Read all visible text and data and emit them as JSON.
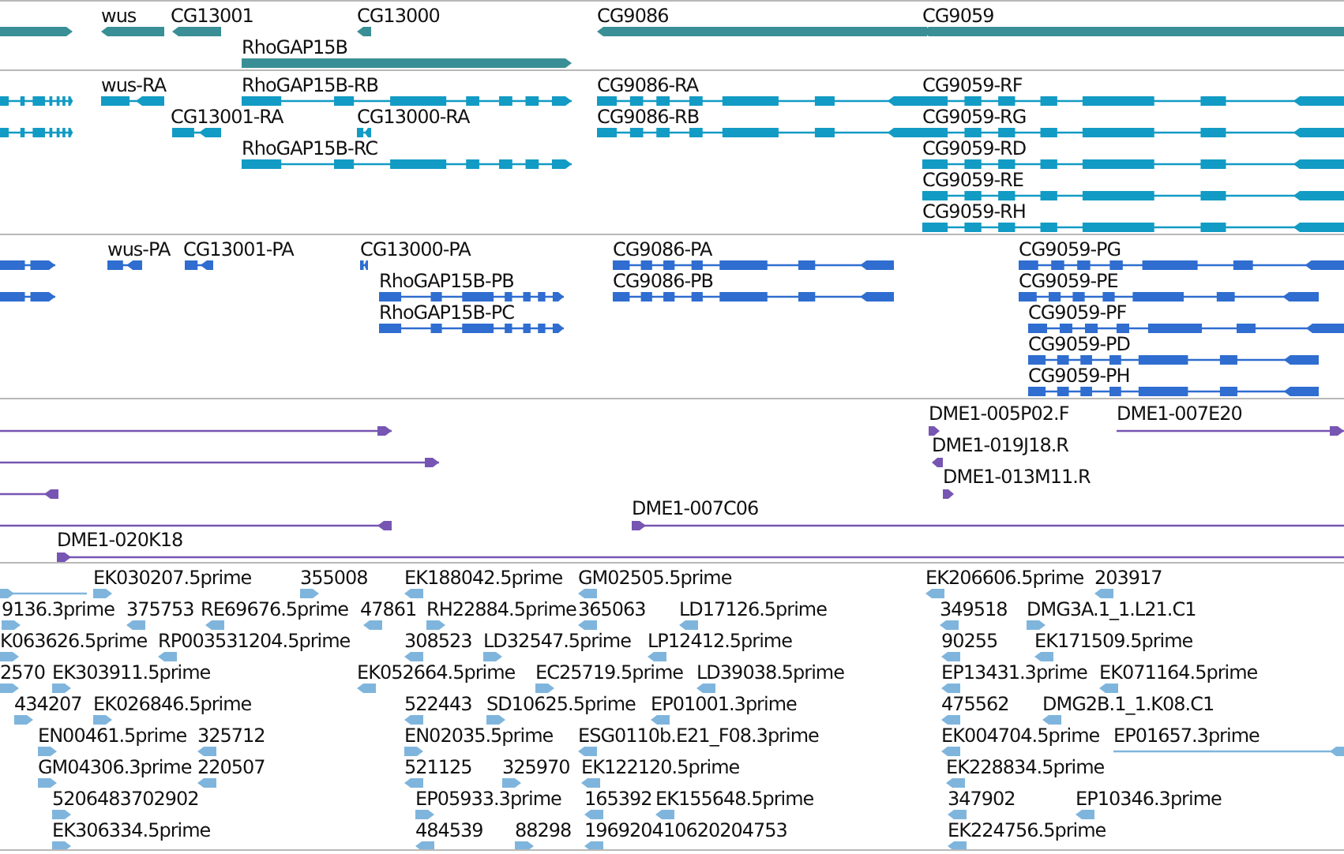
{
  "tracks": [
    {
      "kind": "gene",
      "features": [
        {
          "reverse": false
        },
        {
          "label": "wus",
          "reverse": true
        },
        {
          "label": "CG13001",
          "reverse": true
        },
        {
          "label": "CG13000",
          "reverse": true
        },
        {
          "label": "CG9086",
          "reverse": true
        },
        {
          "label": "CG9059",
          "reverse": true
        },
        {
          "label": "RhoGAP15B",
          "reverse": false
        }
      ]
    },
    {
      "kind": "transcript",
      "features": [
        {
          "reverse": false
        },
        {
          "label": "wus-RA",
          "reverse": true
        },
        {
          "label": "RhoGAP15B-RB",
          "reverse": false
        },
        {
          "label": "CG9086-RA",
          "reverse": true
        },
        {
          "label": "CG9059-RF",
          "reverse": true
        },
        {
          "reverse": false
        },
        {
          "label": "CG13001-RA",
          "reverse": true
        },
        {
          "label": "CG13000-RA",
          "reverse": true
        },
        {
          "label": "CG9086-RB",
          "reverse": true
        },
        {
          "label": "CG9059-RG",
          "reverse": true
        },
        {
          "label": "RhoGAP15B-RC",
          "reverse": false
        },
        {
          "label": "CG9059-RD",
          "reverse": true
        },
        {
          "label": "CG9059-RE",
          "reverse": true
        },
        {
          "label": "CG9059-RH",
          "reverse": true
        }
      ]
    },
    {
      "kind": "protein",
      "features": [
        {
          "reverse": false
        },
        {
          "label": "wus-PA",
          "reverse": true
        },
        {
          "label": "CG13001-PA",
          "reverse": true
        },
        {
          "label": "CG13000-PA",
          "reverse": true
        },
        {
          "label": "CG9086-PA",
          "reverse": true
        },
        {
          "label": "CG9059-PG",
          "reverse": true
        },
        {
          "reverse": false
        },
        {
          "label": "RhoGAP15B-PB",
          "reverse": false
        },
        {
          "label": "CG9086-PB",
          "reverse": true
        },
        {
          "label": "CG9059-PE",
          "reverse": true
        },
        {
          "label": "RhoGAP15B-PC",
          "reverse": false
        },
        {
          "label": "CG9059-PF",
          "reverse": true
        },
        {
          "label": "CG9059-PD",
          "reverse": true
        },
        {
          "label": "CG9059-PH",
          "reverse": true
        }
      ]
    },
    {
      "kind": "clone",
      "features": [
        {
          "reverse": false
        },
        {
          "label": "DME1-005P02.F",
          "reverse": false
        },
        {
          "label": "DME1-007E20",
          "reverse": false
        },
        {
          "reverse": false
        },
        {
          "label": "DME1-019J18.R",
          "reverse": true
        },
        {
          "reverse": true
        },
        {
          "label": "DME1-013M11.R",
          "reverse": false
        },
        {
          "reverse": true
        },
        {
          "label": "DME1-007C06",
          "reverse": false
        },
        {
          "label": "DME1-020K18",
          "reverse": false
        }
      ]
    },
    {
      "kind": "est",
      "features": [
        {
          "reverse": false
        },
        {
          "label": "EK030207.5prime",
          "reverse": false
        },
        {
          "label": "355008",
          "reverse": false
        },
        {
          "label": "EK188042.5prime",
          "reverse": true
        },
        {
          "label": "GM02505.5prime",
          "reverse": true
        },
        {
          "label": "EK206606.5prime",
          "reverse": true
        },
        {
          "label": "203917",
          "reverse": true
        },
        {
          "label": "9136.3prime",
          "reverse": false
        },
        {
          "label": "375753",
          "reverse": true
        },
        {
          "label": "RE69676.5prime",
          "reverse": true
        },
        {
          "label": "47861",
          "reverse": true
        },
        {
          "label": "RH22884.5prime",
          "reverse": false
        },
        {
          "label": "365063",
          "reverse": true
        },
        {
          "label": "LD17126.5prime",
          "reverse": true
        },
        {
          "label": "349518",
          "reverse": true
        },
        {
          "label": "DMG3A.1_1.L21.C1",
          "reverse": false
        },
        {
          "label": "K063626.5prime",
          "reverse": false
        },
        {
          "label": "RP003531204.5prime",
          "reverse": true
        },
        {
          "label": "308523",
          "reverse": true
        },
        {
          "label": "LD32547.5prime",
          "reverse": false
        },
        {
          "label": "LP12412.5prime",
          "reverse": true
        },
        {
          "label": "90255",
          "reverse": true
        },
        {
          "label": "EK171509.5prime",
          "reverse": true
        },
        {
          "label": "2570",
          "reverse": false
        },
        {
          "label": "EK303911.5prime",
          "reverse": false
        },
        {
          "label": "EK052664.5prime",
          "reverse": true
        },
        {
          "label": "EC25719.5prime",
          "reverse": false
        },
        {
          "label": "LD39038.5prime",
          "reverse": true
        },
        {
          "label": "EP13431.3prime",
          "reverse": true
        },
        {
          "label": "EK071164.5prime",
          "reverse": true
        },
        {
          "label": "434207",
          "reverse": false
        },
        {
          "label": "EK026846.5prime",
          "reverse": false
        },
        {
          "label": "522443",
          "reverse": true
        },
        {
          "label": "SD10625.5prime",
          "reverse": false
        },
        {
          "label": "EP01001.3prime",
          "reverse": true
        },
        {
          "label": "475562",
          "reverse": true
        },
        {
          "label": "DMG2B.1_1.K08.C1",
          "reverse": true
        },
        {
          "label": "EN00461.5prime",
          "reverse": false
        },
        {
          "label": "325712",
          "reverse": true
        },
        {
          "label": "EN02035.5prime",
          "reverse": false
        },
        {
          "label": "ESG0110b.E21_F08.3prime",
          "reverse": true
        },
        {
          "label": "EK004704.5prime",
          "reverse": true
        },
        {
          "label": "EP01657.3prime",
          "reverse": true
        },
        {
          "label": "GM04306.3prime",
          "reverse": false
        },
        {
          "label": "220507",
          "reverse": true
        },
        {
          "label": "521125",
          "reverse": true
        },
        {
          "label": "325970",
          "reverse": false
        },
        {
          "label": "EK122120.5prime",
          "reverse": true
        },
        {
          "label": "EK228834.5prime",
          "reverse": true
        },
        {
          "label": "5206483702902",
          "reverse": false
        },
        {
          "label": "EP05933.3prime",
          "reverse": false
        },
        {
          "label": "165392",
          "reverse": true
        },
        {
          "label": "EK155648.5prime",
          "reverse": true
        },
        {
          "label": "347902",
          "reverse": true
        },
        {
          "label": "EP10346.3prime",
          "reverse": true
        },
        {
          "label": "EK306334.5prime",
          "reverse": false
        },
        {
          "label": "484539",
          "reverse": true
        },
        {
          "label": "88298",
          "reverse": false
        },
        {
          "label": "196920410620204753",
          "reverse": true
        },
        {
          "label": "EK224756.5prime",
          "reverse": true
        }
      ]
    }
  ]
}
